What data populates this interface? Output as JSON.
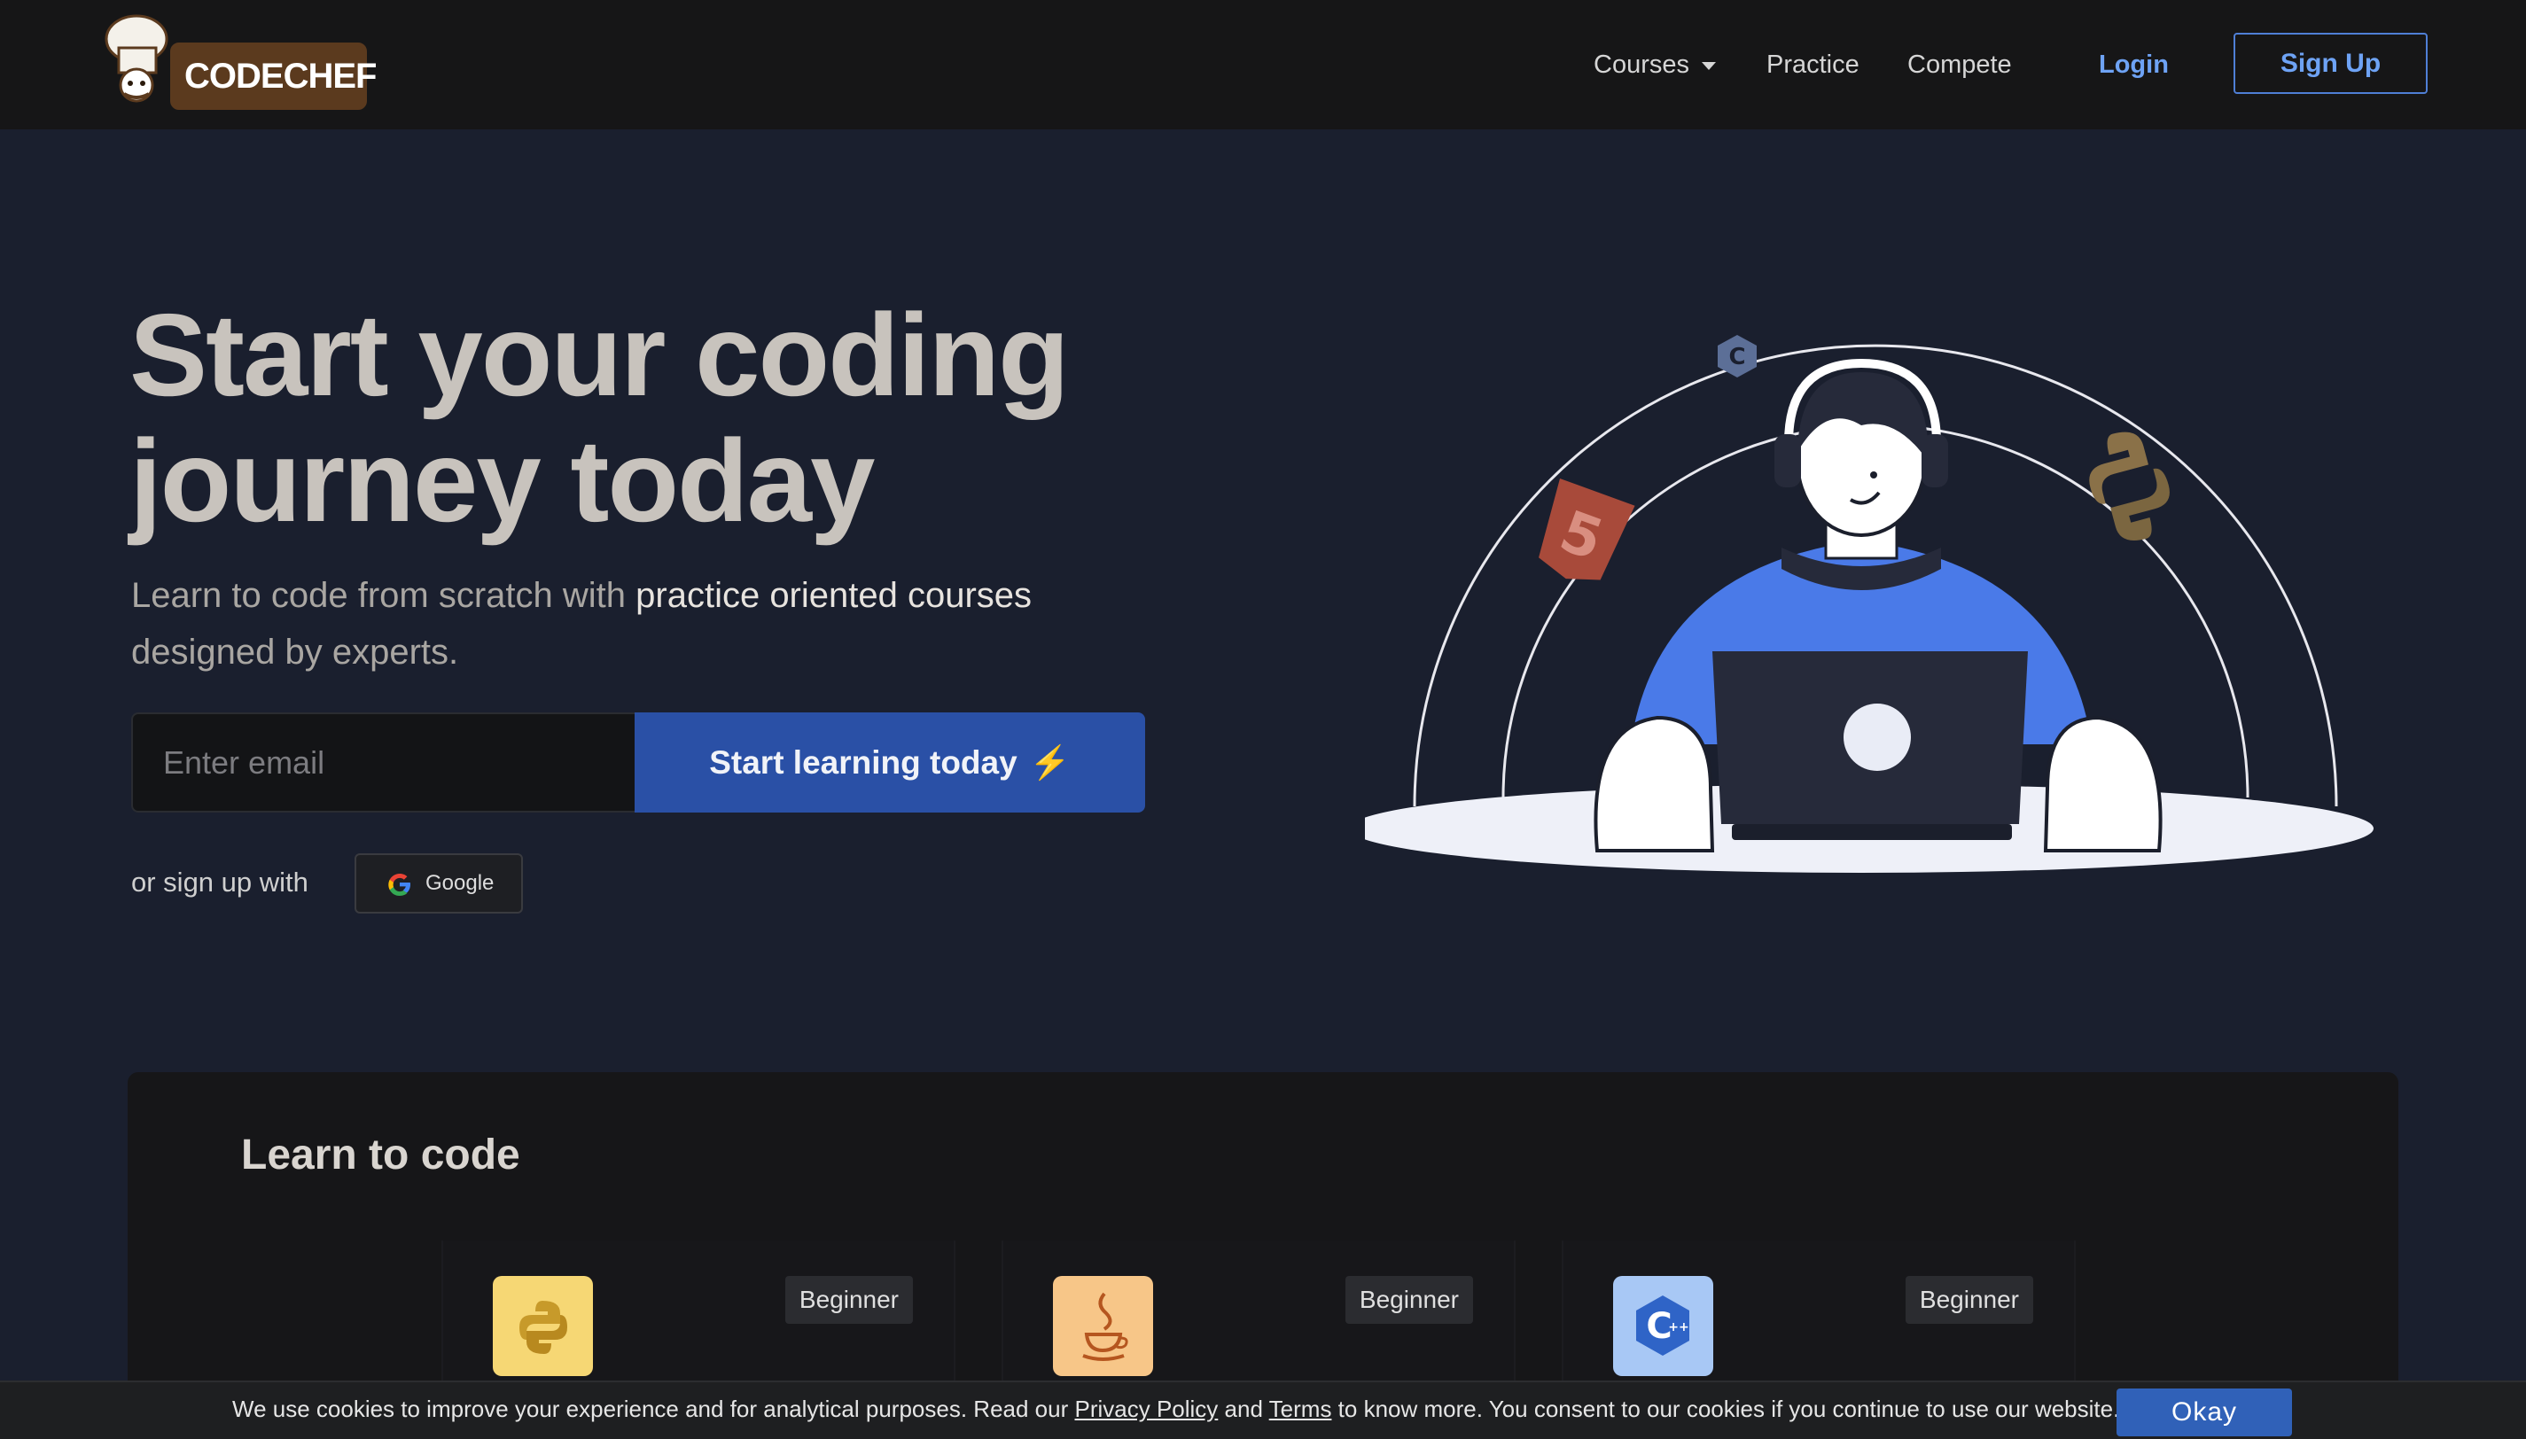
{
  "header": {
    "brand": "CODECHEF",
    "nav": {
      "courses": "Courses",
      "practice": "Practice",
      "compete": "Compete",
      "login": "Login",
      "signup": "Sign Up"
    }
  },
  "hero": {
    "title_line1": "Start your coding",
    "title_line2": "journey today",
    "subtitle_plain": "Learn to code from scratch with ",
    "subtitle_highlight": "practice oriented courses",
    "subtitle_end": "designed by experts.",
    "email_placeholder": "Enter email",
    "cta_label": "Start learning today",
    "or_signup": "or sign up with",
    "google_label": "Google"
  },
  "learn": {
    "title": "Learn to code",
    "courses": [
      {
        "icon": "python-icon",
        "level": "Beginner",
        "color": "#f6d774"
      },
      {
        "icon": "java-icon",
        "level": "Beginner",
        "color": "#f7c688"
      },
      {
        "icon": "cpp-icon",
        "level": "Beginner",
        "color": "#a8c8f5"
      }
    ]
  },
  "cookie": {
    "text_before": "We use cookies to improve your experience and for analytical purposes. Read our ",
    "privacy": "Privacy Policy",
    "and": " and ",
    "terms": "Terms",
    "text_after": " to know more. You consent to our cookies if you continue to use our website.",
    "okay": "Okay"
  },
  "colors": {
    "background": "#1a1f2e",
    "header": "#161617",
    "accent": "#2a50a6",
    "link": "#6ea3f5"
  }
}
